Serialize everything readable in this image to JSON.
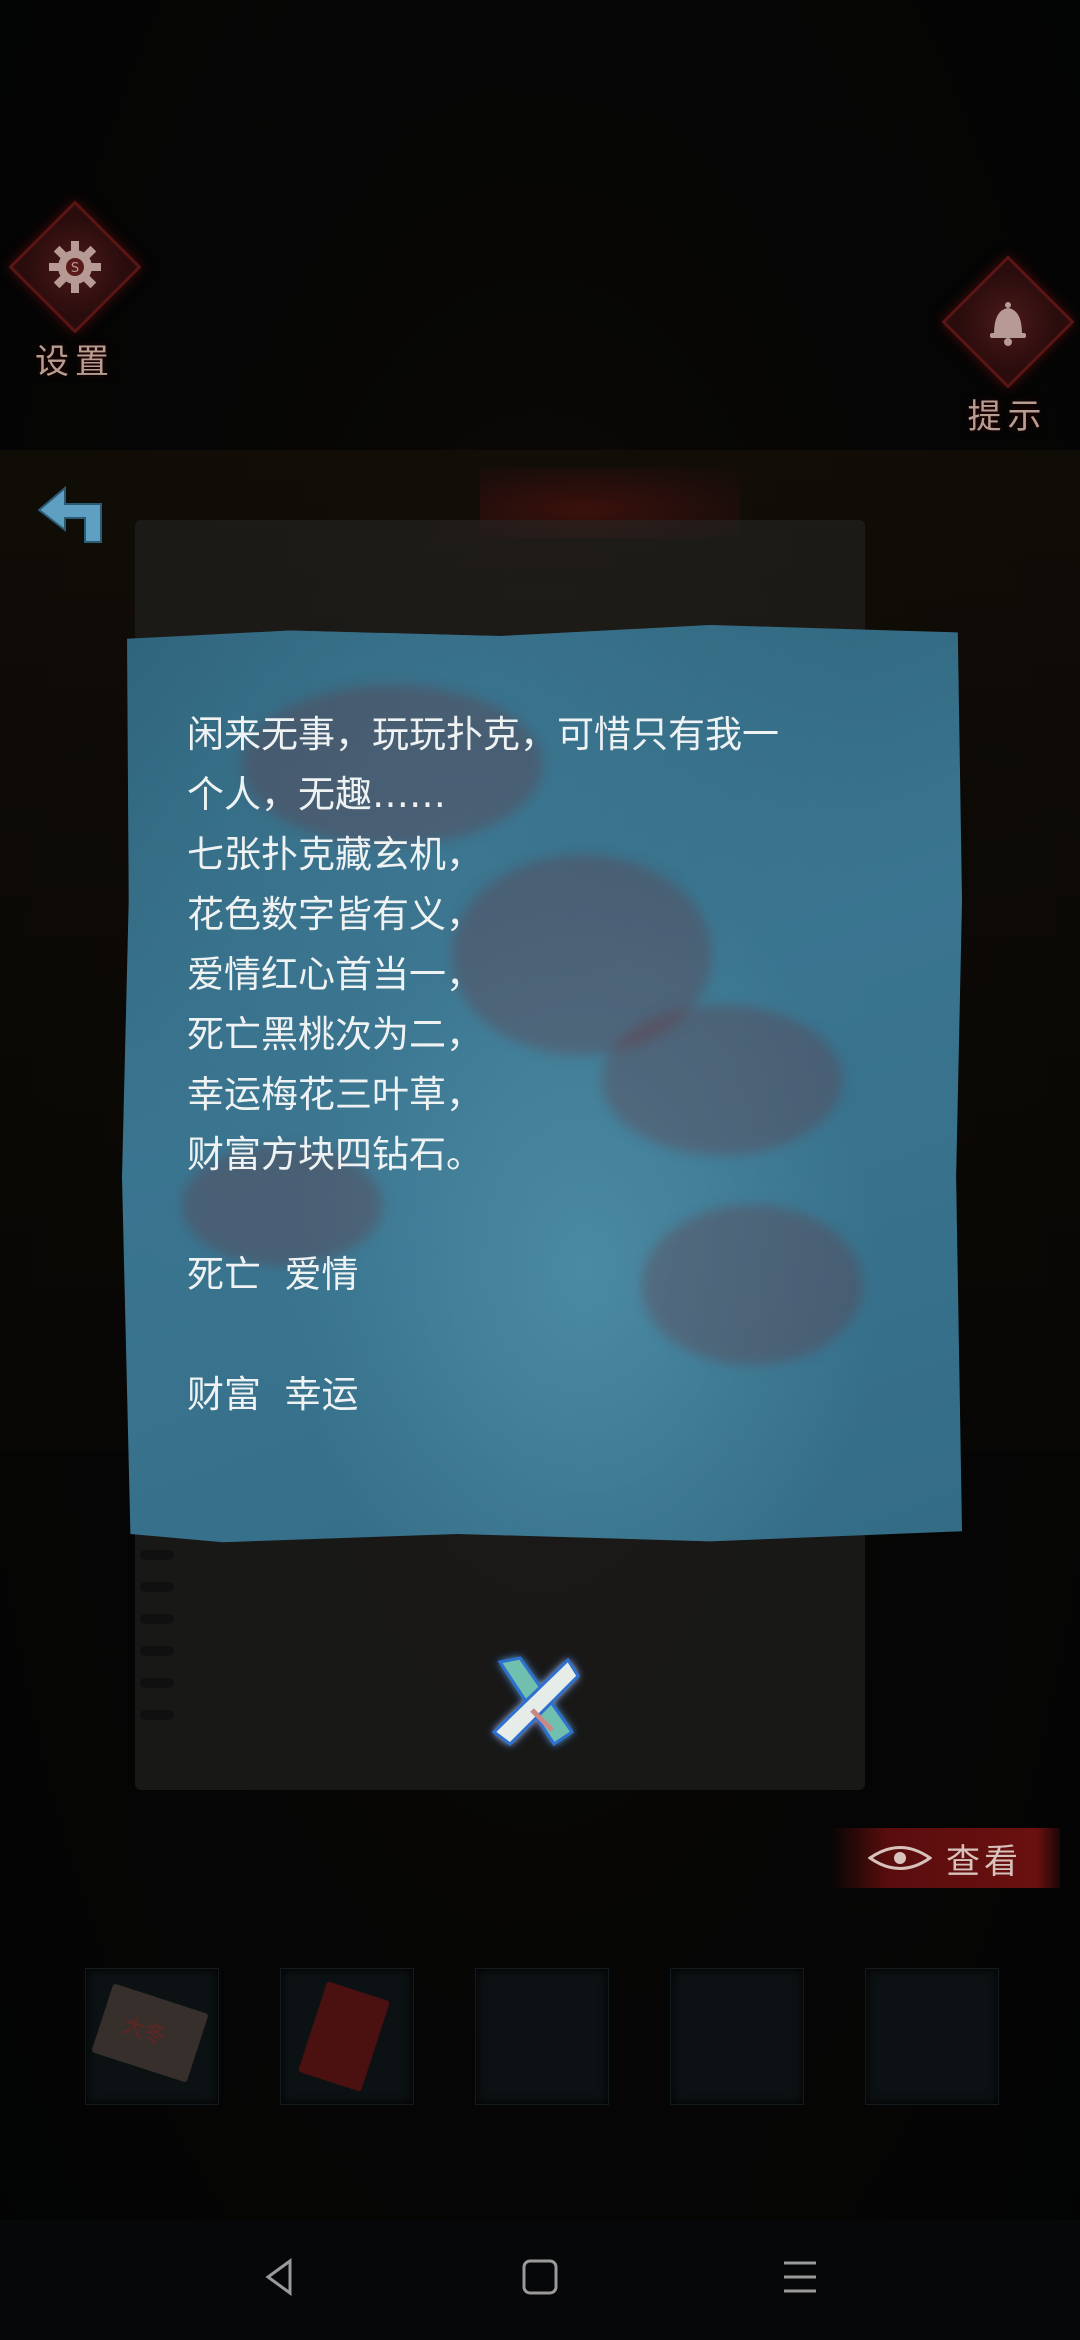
{
  "hud": {
    "settings_label": "设置",
    "hint_label": "提示",
    "view_label": "查看"
  },
  "note": {
    "lines": [
      "闲来无事，玩玩扑克，可惜只有我一",
      "个人，无趣……",
      "七张扑克藏玄机，",
      "花色数字皆有义，",
      "爱情红心首当一，",
      "死亡黑桃次为二，",
      "幸运梅花三叶草，",
      "财富方块四钻石。"
    ],
    "grid_row1": "死亡  爱情",
    "grid_row2": "财富  幸运"
  },
  "inventory": {
    "slot1_item": "大冬"
  },
  "icons": {
    "settings": "gear-icon",
    "hint": "bell-icon",
    "back": "back-arrow-icon",
    "close": "close-icon",
    "view": "eye-icon"
  },
  "colors": {
    "note_paper": "#3a7590",
    "accent_red": "#6a1010",
    "text": "#eef2f3"
  }
}
